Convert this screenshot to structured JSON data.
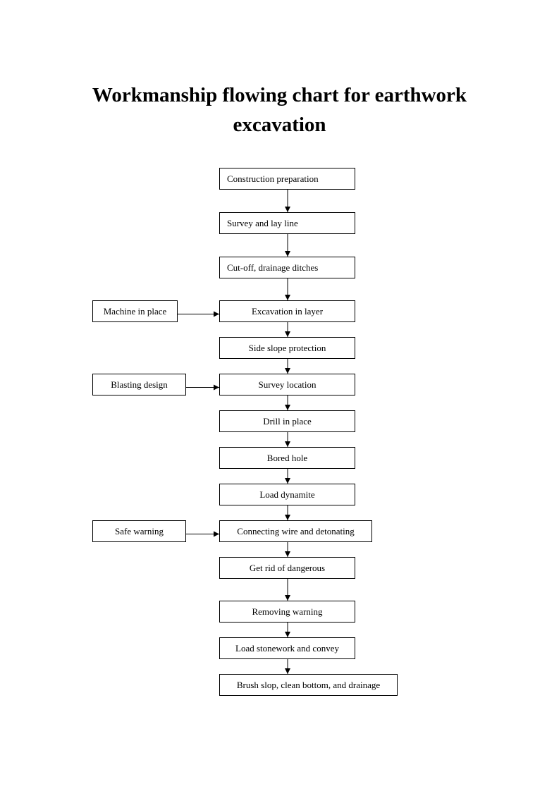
{
  "title": {
    "line1": "Workmanship flowing chart for earthwork",
    "line2": "excavation"
  },
  "main_steps": [
    {
      "id": "construction-preparation",
      "label": "Construction preparation"
    },
    {
      "id": "survey-and-lay-line",
      "label": "Survey and lay line"
    },
    {
      "id": "cut-off-drainage-ditches",
      "label": "Cut-off, drainage ditches"
    },
    {
      "id": "excavation-in-layer",
      "label": "Excavation in layer"
    },
    {
      "id": "side-slope-protection",
      "label": "Side slope protection"
    },
    {
      "id": "survey-location",
      "label": "Survey location"
    },
    {
      "id": "drill-in-place",
      "label": "Drill in place"
    },
    {
      "id": "bored-hole",
      "label": "Bored hole"
    },
    {
      "id": "load-dynamite",
      "label": "Load dynamite"
    },
    {
      "id": "connecting-wire-and-detonating",
      "label": "Connecting wire and detonating"
    },
    {
      "id": "get-rid-of-dangerous",
      "label": "Get rid of dangerous"
    },
    {
      "id": "removing-warning",
      "label": "Removing warning"
    },
    {
      "id": "load-stonework-and-convey",
      "label": "Load stonework and convey"
    },
    {
      "id": "brush-slop-clean-bottom-drainage",
      "label": "Brush slop, clean bottom, and drainage"
    }
  ],
  "side_inputs": [
    {
      "id": "machine-in-place",
      "label": "Machine in place",
      "feeds": "excavation-in-layer"
    },
    {
      "id": "blasting-design",
      "label": "Blasting design",
      "feeds": "survey-location"
    },
    {
      "id": "safe-warning",
      "label": "Safe warning",
      "feeds": "connecting-wire-and-detonating"
    }
  ],
  "flow_edges": [
    [
      "construction-preparation",
      "survey-and-lay-line"
    ],
    [
      "survey-and-lay-line",
      "cut-off-drainage-ditches"
    ],
    [
      "cut-off-drainage-ditches",
      "excavation-in-layer"
    ],
    [
      "excavation-in-layer",
      "side-slope-protection"
    ],
    [
      "side-slope-protection",
      "survey-location"
    ],
    [
      "survey-location",
      "drill-in-place"
    ],
    [
      "drill-in-place",
      "bored-hole"
    ],
    [
      "bored-hole",
      "load-dynamite"
    ],
    [
      "load-dynamite",
      "connecting-wire-and-detonating"
    ],
    [
      "connecting-wire-and-detonating",
      "get-rid-of-dangerous"
    ],
    [
      "get-rid-of-dangerous",
      "removing-warning"
    ],
    [
      "removing-warning",
      "load-stonework-and-convey"
    ],
    [
      "load-stonework-and-convey",
      "brush-slop-clean-bottom-drainage"
    ],
    [
      "machine-in-place",
      "excavation-in-layer"
    ],
    [
      "blasting-design",
      "survey-location"
    ],
    [
      "safe-warning",
      "connecting-wire-and-detonating"
    ]
  ]
}
